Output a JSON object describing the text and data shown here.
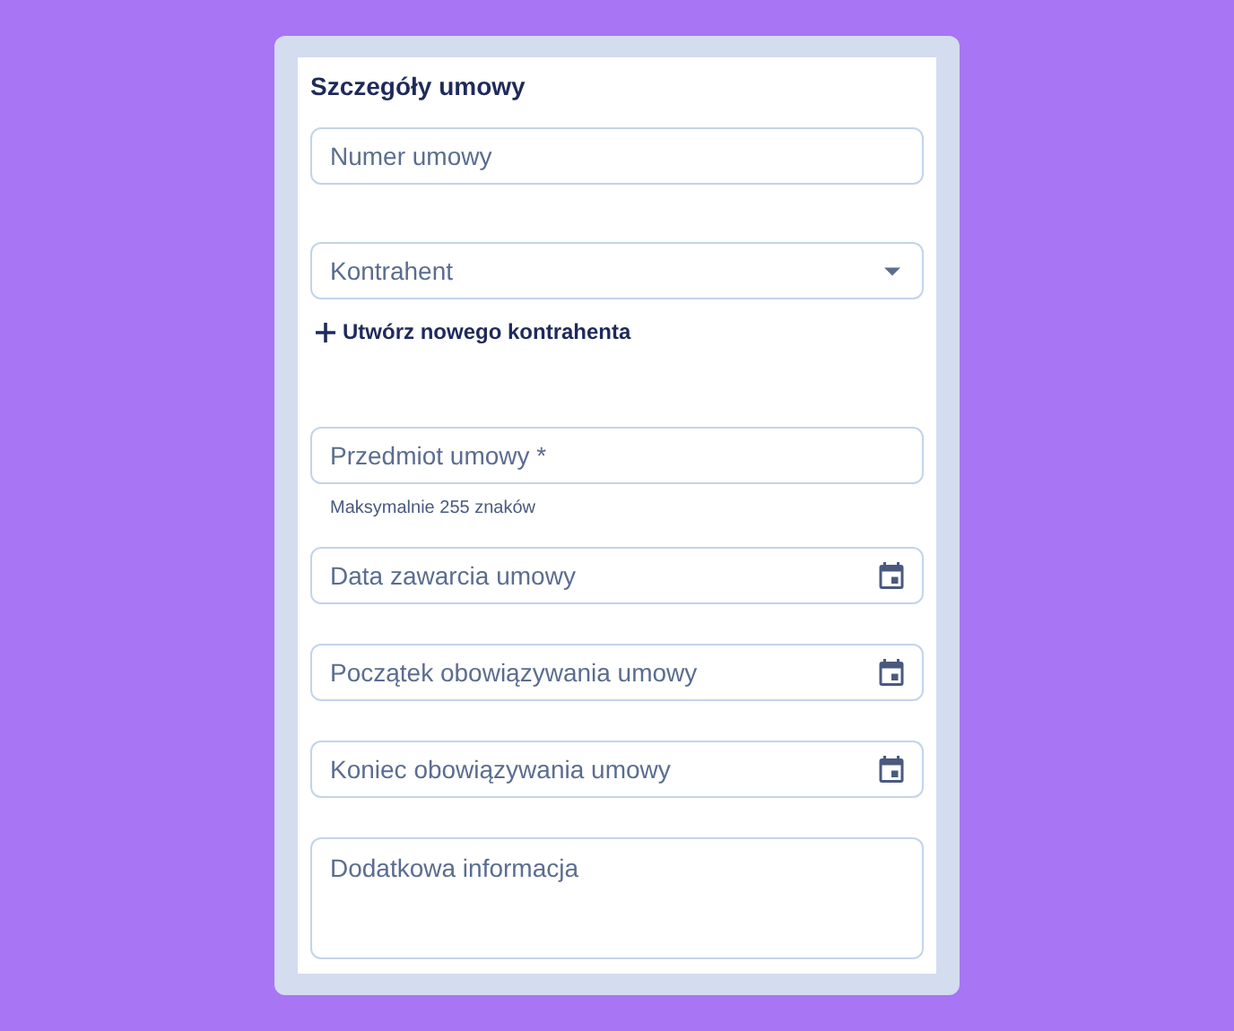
{
  "form": {
    "title": "Szczegóły umowy",
    "fields": [
      {
        "kind": "text",
        "placeholder": "Numer umowy"
      },
      {
        "kind": "select",
        "placeholder": "Kontrahent",
        "action": "Utwórz nowego kontrahenta"
      },
      {
        "kind": "text",
        "placeholder": "Przedmiot umowy *",
        "helper": "Maksymalnie 255 znaków"
      },
      {
        "kind": "date",
        "placeholder": "Data zawarcia umowy"
      },
      {
        "kind": "date",
        "placeholder": "Początek obowiązywania umowy"
      },
      {
        "kind": "date",
        "placeholder": "Koniec obowiązywania umowy"
      },
      {
        "kind": "textarea",
        "placeholder": "Dodatkowa informacja"
      }
    ]
  }
}
